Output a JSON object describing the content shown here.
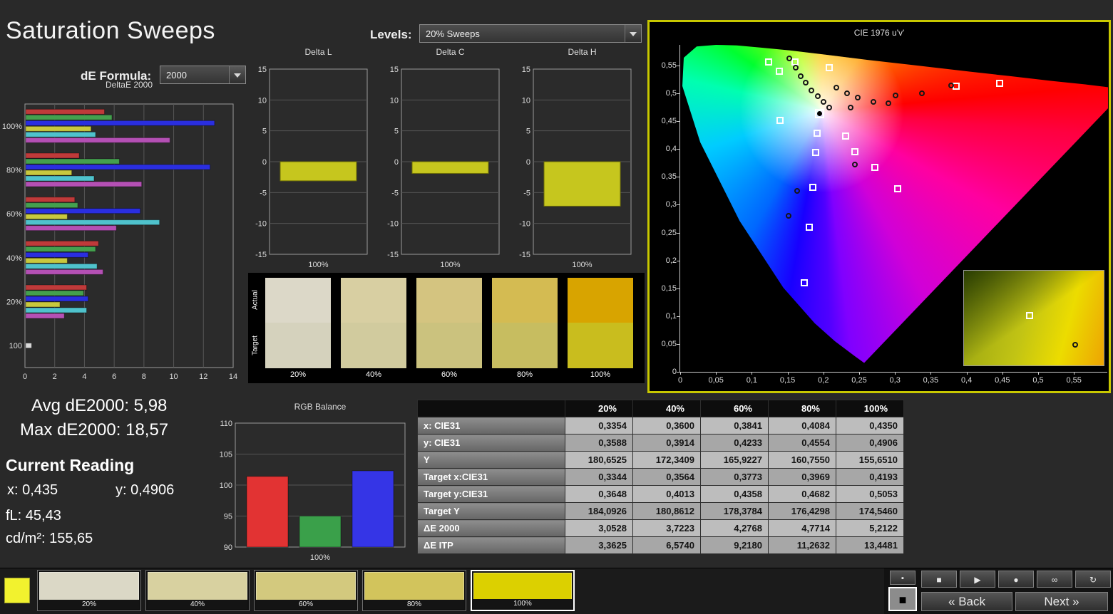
{
  "header": {
    "title": "Saturation Sweeps"
  },
  "controls": {
    "levels_label": "Levels:",
    "levels_value": "20% Sweeps",
    "de_formula_label": "dE Formula:",
    "de_formula_value": "2000"
  },
  "stats": {
    "avg": "Avg dE2000: 5,98",
    "max": "Max dE2000: 18,57",
    "current_reading": "Current Reading",
    "x": "x: 0,435",
    "y": "y: 0,4906",
    "fl": "fL: 45,43",
    "cd": "cd/m²: 155,65"
  },
  "swatch_panel": {
    "actual_label": "Actual",
    "target_label": "Target",
    "columns": [
      {
        "label": "20%",
        "actual": "#dcd8c8",
        "target": "#d5d2bd"
      },
      {
        "label": "40%",
        "actual": "#d8cfa2",
        "target": "#d1cb9e"
      },
      {
        "label": "60%",
        "actual": "#d4c480",
        "target": "#cbc27e"
      },
      {
        "label": "80%",
        "actual": "#d4bb52",
        "target": "#c7bd60"
      },
      {
        "label": "100%",
        "actual": "#d8a400",
        "target": "#c9bd1e"
      }
    ]
  },
  "table": {
    "headers": [
      "",
      "20%",
      "40%",
      "60%",
      "80%",
      "100%"
    ],
    "rows": [
      {
        "label": "x: CIE31",
        "values": [
          "0,3354",
          "0,3600",
          "0,3841",
          "0,4084",
          "0,4350"
        ]
      },
      {
        "label": "y: CIE31",
        "values": [
          "0,3588",
          "0,3914",
          "0,4233",
          "0,4554",
          "0,4906"
        ]
      },
      {
        "label": "Y",
        "values": [
          "180,6525",
          "172,3409",
          "165,9227",
          "160,7550",
          "155,6510"
        ]
      },
      {
        "label": "Target x:CIE31",
        "values": [
          "0,3344",
          "0,3564",
          "0,3773",
          "0,3969",
          "0,4193"
        ]
      },
      {
        "label": "Target y:CIE31",
        "values": [
          "0,3648",
          "0,4013",
          "0,4358",
          "0,4682",
          "0,5053"
        ]
      },
      {
        "label": "Target Y",
        "values": [
          "184,0926",
          "180,8612",
          "178,3784",
          "176,4298",
          "174,5460"
        ]
      },
      {
        "label": "ΔE 2000",
        "values": [
          "3,0528",
          "3,7223",
          "4,2768",
          "4,7714",
          "5,2122"
        ]
      },
      {
        "label": "ΔE ITP",
        "values": [
          "3,3625",
          "6,5740",
          "9,2180",
          "11,2632",
          "13,4481"
        ]
      }
    ]
  },
  "bottom_bar": {
    "corner_color": "#f2f22e",
    "patches": [
      {
        "label": "20%",
        "color": "#dbd8c6",
        "selected": false
      },
      {
        "label": "40%",
        "color": "#d8d1a0",
        "selected": false
      },
      {
        "label": "60%",
        "color": "#d3c97e",
        "selected": false
      },
      {
        "label": "80%",
        "color": "#d2c45c",
        "selected": false
      },
      {
        "label": "100%",
        "color": "#dcd000",
        "selected": true
      }
    ],
    "pattern_small_glyph": "▪",
    "pattern_large_glyph": "■",
    "transport": [
      {
        "name": "stop",
        "glyph": "■"
      },
      {
        "name": "play",
        "glyph": "▶"
      },
      {
        "name": "record",
        "glyph": "●"
      },
      {
        "name": "loop",
        "glyph": "∞"
      },
      {
        "name": "refresh",
        "glyph": "↻"
      }
    ],
    "back_glyph": "«",
    "back_label": "Back",
    "next_label": "Next",
    "next_glyph": "»"
  },
  "chart_data": [
    {
      "id": "deltae2000",
      "type": "bar",
      "orientation": "horizontal",
      "title": "DeltaE 2000",
      "group_labels": [
        "100%",
        "80%",
        "60%",
        "40%",
        "20%",
        "100"
      ],
      "series": [
        {
          "name": "Red",
          "color": "#bf3a3a",
          "values": [
            5.3,
            3.6,
            3.3,
            4.9,
            4.1,
            0
          ]
        },
        {
          "name": "Green",
          "color": "#44a04e",
          "values": [
            5.8,
            6.3,
            3.5,
            4.7,
            3.9,
            0
          ]
        },
        {
          "name": "Blue",
          "color": "#2a2ee0",
          "values": [
            12.7,
            12.4,
            7.7,
            4.2,
            4.2,
            0
          ]
        },
        {
          "name": "Yellow",
          "color": "#c8c83e",
          "values": [
            4.4,
            3.1,
            2.8,
            2.8,
            2.3,
            0
          ]
        },
        {
          "name": "Cyan",
          "color": "#4fc2cc",
          "values": [
            4.7,
            4.6,
            9.0,
            4.8,
            4.1,
            0
          ]
        },
        {
          "name": "Magenta",
          "color": "#b450b4",
          "values": [
            9.7,
            7.8,
            6.1,
            5.2,
            2.6,
            0
          ]
        },
        {
          "name": "White",
          "color": "#d9d9d9",
          "values": [
            0,
            0,
            0,
            0,
            0,
            0.4
          ]
        }
      ],
      "x_ticks": [
        "0",
        "2",
        "4",
        "6",
        "8",
        "10",
        "12",
        "14"
      ],
      "xlim": [
        0,
        14
      ]
    },
    {
      "id": "delta_l",
      "type": "bar",
      "title": "Delta L",
      "value": -3.1,
      "bar_color": "#c6c61e",
      "ylim": [
        -15,
        15
      ],
      "y_ticks": [
        "15",
        "10",
        "5",
        "0",
        "-5",
        "-10",
        "-15"
      ],
      "xlabel": "100%"
    },
    {
      "id": "delta_c",
      "type": "bar",
      "title": "Delta C",
      "value": -1.9,
      "bar_color": "#c6c61e",
      "ylim": [
        -15,
        15
      ],
      "y_ticks": [
        "15",
        "10",
        "5",
        "0",
        "-5",
        "-10",
        "-15"
      ],
      "xlabel": "100%"
    },
    {
      "id": "delta_h",
      "type": "bar",
      "title": "Delta H",
      "value": -7.2,
      "bar_color": "#c6c61e",
      "ylim": [
        -15,
        15
      ],
      "y_ticks": [
        "15",
        "10",
        "5",
        "0",
        "-5",
        "-10",
        "-15"
      ],
      "xlabel": "100%"
    },
    {
      "id": "rgb_balance",
      "type": "bar",
      "title": "RGB Balance",
      "categories": [
        "Red",
        "Green",
        "Blue"
      ],
      "values": [
        101.4,
        95.0,
        102.3
      ],
      "colors": [
        "#e23333",
        "#3aa04a",
        "#3535e6"
      ],
      "ylim": [
        90,
        110
      ],
      "y_ticks": [
        "110",
        "105",
        "100",
        "95",
        "90"
      ],
      "xlabel": "100%"
    },
    {
      "id": "cie",
      "type": "scatter",
      "title": "CIE 1976 u'v'",
      "x_ticks": [
        "0",
        "0,05",
        "0,1",
        "0,15",
        "0,2",
        "0,25",
        "0,3",
        "0,35",
        "0,4",
        "0,45",
        "0,5",
        "0,55"
      ],
      "y_ticks": [
        "0",
        "0,05",
        "0,1",
        "0,15",
        "0,2",
        "0,25",
        "0,3",
        "0,35",
        "0,4",
        "0,45",
        "0,5",
        "0,55"
      ],
      "xlim": [
        0,
        0.6
      ],
      "ylim": [
        0,
        0.6
      ],
      "white_point": [
        0.1978,
        0.4683
      ],
      "locus": [
        [
          0.623,
          0.507
        ],
        [
          0.566,
          0.516
        ],
        [
          0.52,
          0.522
        ],
        [
          0.46,
          0.531
        ],
        [
          0.404,
          0.539
        ],
        [
          0.33,
          0.55
        ],
        [
          0.262,
          0.56
        ],
        [
          0.205,
          0.569
        ],
        [
          0.153,
          0.577
        ],
        [
          0.113,
          0.582
        ],
        [
          0.079,
          0.586
        ],
        [
          0.05,
          0.587
        ],
        [
          0.023,
          0.584
        ],
        [
          0.005,
          0.564
        ],
        [
          0.003,
          0.513
        ],
        [
          0.028,
          0.412
        ],
        [
          0.083,
          0.271
        ],
        [
          0.144,
          0.151
        ],
        [
          0.188,
          0.087
        ],
        [
          0.216,
          0.055
        ],
        [
          0.244,
          0.028
        ],
        [
          0.257,
          0.016
        ]
      ],
      "targets": [
        [
          0.124,
          0.556
        ],
        [
          0.138,
          0.54
        ],
        [
          0.16,
          0.556
        ],
        [
          0.208,
          0.546
        ],
        [
          0.446,
          0.518
        ],
        [
          0.385,
          0.513
        ],
        [
          0.139,
          0.451
        ],
        [
          0.191,
          0.428
        ],
        [
          0.231,
          0.423
        ],
        [
          0.189,
          0.394
        ],
        [
          0.244,
          0.395
        ],
        [
          0.272,
          0.367
        ],
        [
          0.185,
          0.331
        ],
        [
          0.304,
          0.329
        ],
        [
          0.18,
          0.26
        ],
        [
          0.173,
          0.16
        ]
      ],
      "measurements": [
        [
          0.152,
          0.563
        ],
        [
          0.161,
          0.546
        ],
        [
          0.168,
          0.531
        ],
        [
          0.175,
          0.519
        ],
        [
          0.183,
          0.505
        ],
        [
          0.192,
          0.495
        ],
        [
          0.2,
          0.485
        ],
        [
          0.208,
          0.475
        ],
        [
          0.218,
          0.51
        ],
        [
          0.233,
          0.5
        ],
        [
          0.248,
          0.492
        ],
        [
          0.27,
          0.485
        ],
        [
          0.291,
          0.482
        ],
        [
          0.301,
          0.496
        ],
        [
          0.338,
          0.5
        ],
        [
          0.378,
          0.514
        ],
        [
          0.238,
          0.474
        ],
        [
          0.244,
          0.372
        ],
        [
          0.163,
          0.325
        ],
        [
          0.151,
          0.28
        ]
      ],
      "current": [
        0.194,
        0.464
      ]
    }
  ]
}
